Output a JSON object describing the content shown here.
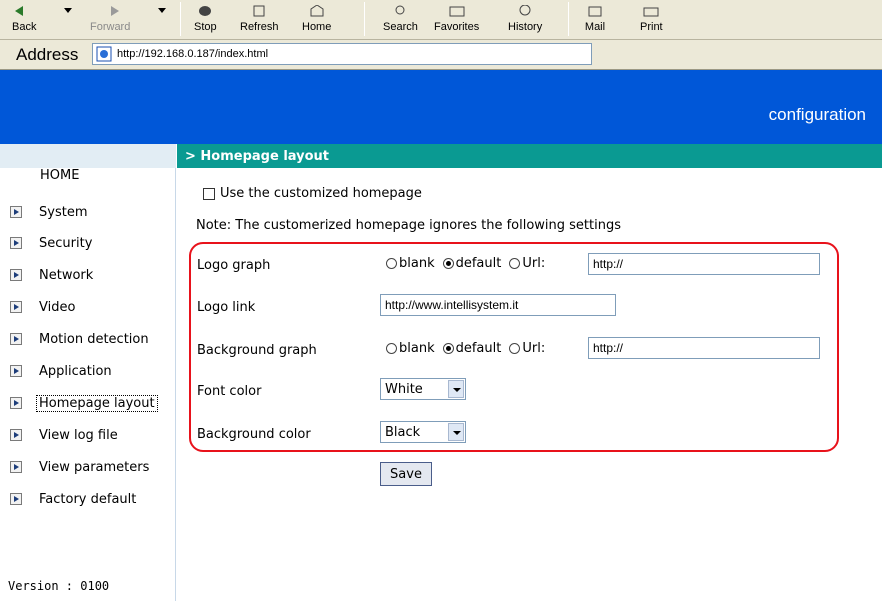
{
  "browser": {
    "toolbar": {
      "back": "Back",
      "forward": "Forward",
      "stop": "Stop",
      "refresh": "Refresh",
      "home": "Home",
      "search": "Search",
      "favorites": "Favorites",
      "history": "History",
      "mail": "Mail",
      "print": "Print"
    },
    "address_label": "Address",
    "address_url": "http://192.168.0.187/index.html"
  },
  "header": {
    "title": "configuration"
  },
  "sidebar": {
    "home": "HOME",
    "items": [
      {
        "label": "System"
      },
      {
        "label": "Security"
      },
      {
        "label": "Network"
      },
      {
        "label": "Video"
      },
      {
        "label": "Motion detection"
      },
      {
        "label": "Application"
      },
      {
        "label": "Homepage layout"
      },
      {
        "label": "View log file"
      },
      {
        "label": "View parameters"
      },
      {
        "label": "Factory default"
      }
    ],
    "version": "Version : 0100"
  },
  "main": {
    "section_title": "> Homepage layout",
    "custom_homepage_label": "Use the customized homepage",
    "note": "Note: The customerized homepage ignores the following settings",
    "logo_graph": {
      "label": "Logo graph",
      "options": [
        "blank",
        "default",
        "Url:"
      ],
      "selected": "default",
      "url_value": "http://"
    },
    "logo_link": {
      "label": "Logo link",
      "value": "http://www.intellisystem.it"
    },
    "background_graph": {
      "label": "Background graph",
      "options": [
        "blank",
        "default",
        "Url:"
      ],
      "selected": "default",
      "url_value": "http://"
    },
    "font_color": {
      "label": "Font color",
      "value": "White"
    },
    "background_color": {
      "label": "Background color",
      "value": "Black"
    },
    "save_label": "Save"
  },
  "colors": {
    "header_blue": "#0057d8",
    "section_teal": "#0a9a92",
    "highlight_red": "#e8121b"
  }
}
